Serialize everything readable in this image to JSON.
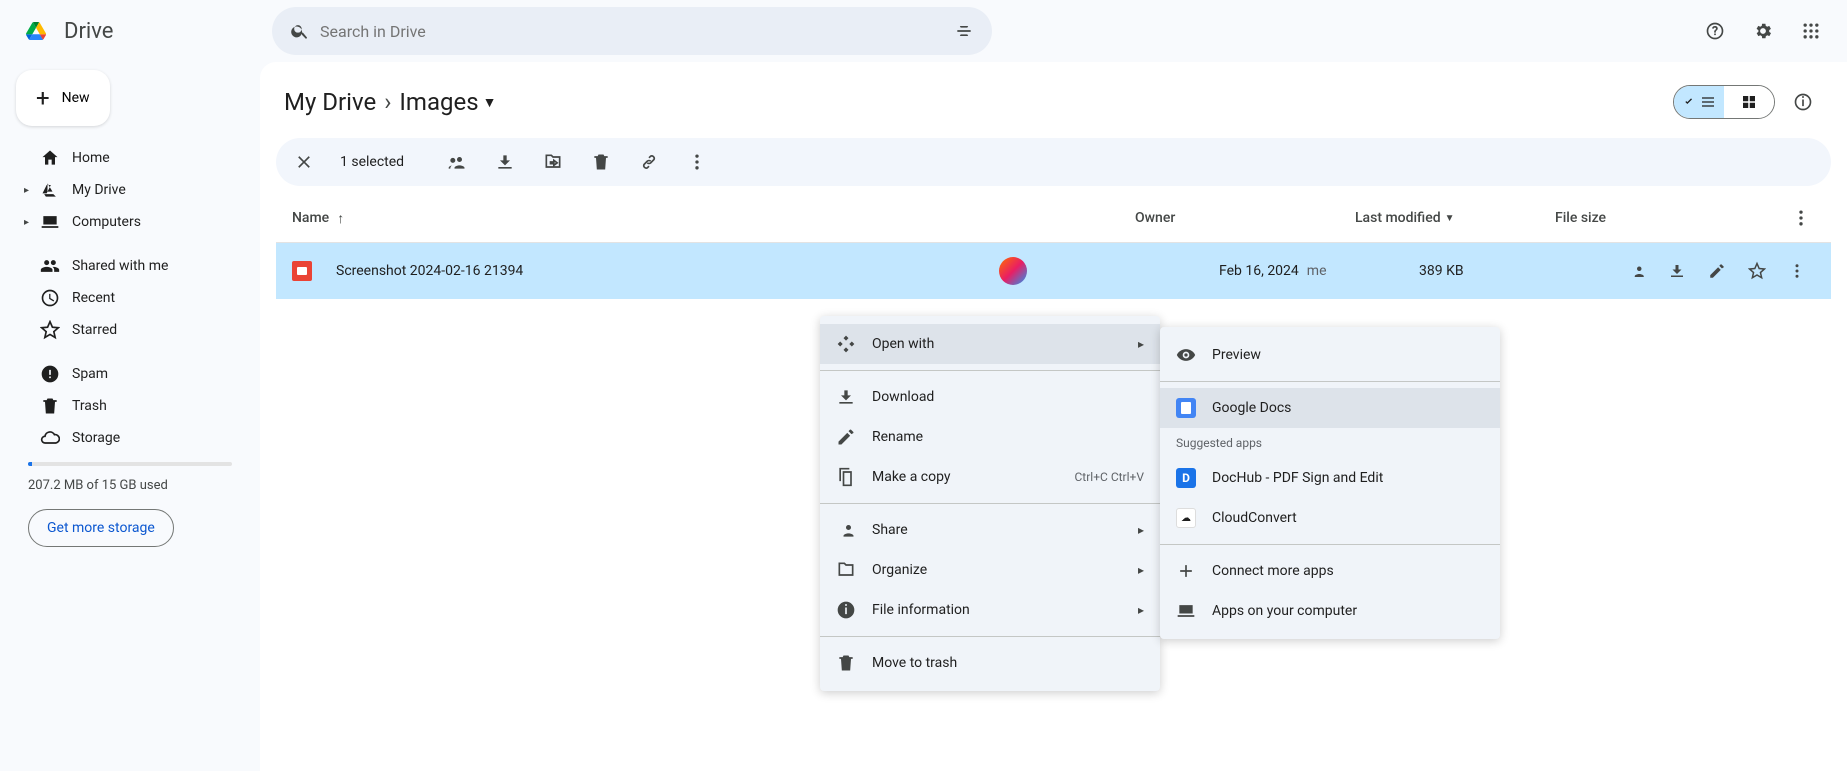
{
  "product_name": "Drive",
  "search": {
    "placeholder": "Search in Drive"
  },
  "new_button": "New",
  "sidebar": {
    "items": [
      {
        "label": "Home"
      },
      {
        "label": "My Drive"
      },
      {
        "label": "Computers"
      },
      {
        "label": "Shared with me"
      },
      {
        "label": "Recent"
      },
      {
        "label": "Starred"
      },
      {
        "label": "Spam"
      },
      {
        "label": "Trash"
      },
      {
        "label": "Storage"
      }
    ],
    "storage_used": "207.2 MB of 15 GB used",
    "get_more": "Get more storage"
  },
  "breadcrumbs": {
    "root": "My Drive",
    "current": "Images"
  },
  "selection": {
    "count": "1 selected"
  },
  "columns": {
    "name": "Name",
    "owner": "Owner",
    "modified": "Last modified",
    "size": "File size"
  },
  "files": [
    {
      "name": "Screenshot 2024-02-16 21394",
      "modified": "Feb 16, 2024",
      "modified_by": "me",
      "size": "389 KB"
    }
  ],
  "context_menu": {
    "open_with": "Open with",
    "download": "Download",
    "rename": "Rename",
    "make_copy": "Make a copy",
    "make_copy_shortcut": "Ctrl+C Ctrl+V",
    "share": "Share",
    "organize": "Organize",
    "file_info": "File information",
    "trash": "Move to trash"
  },
  "open_with_menu": {
    "preview": "Preview",
    "google_docs": "Google Docs",
    "suggested": "Suggested apps",
    "dochub": "DocHub - PDF Sign and Edit",
    "cloudconvert": "CloudConvert",
    "connect": "Connect more apps",
    "computer": "Apps on your computer"
  }
}
